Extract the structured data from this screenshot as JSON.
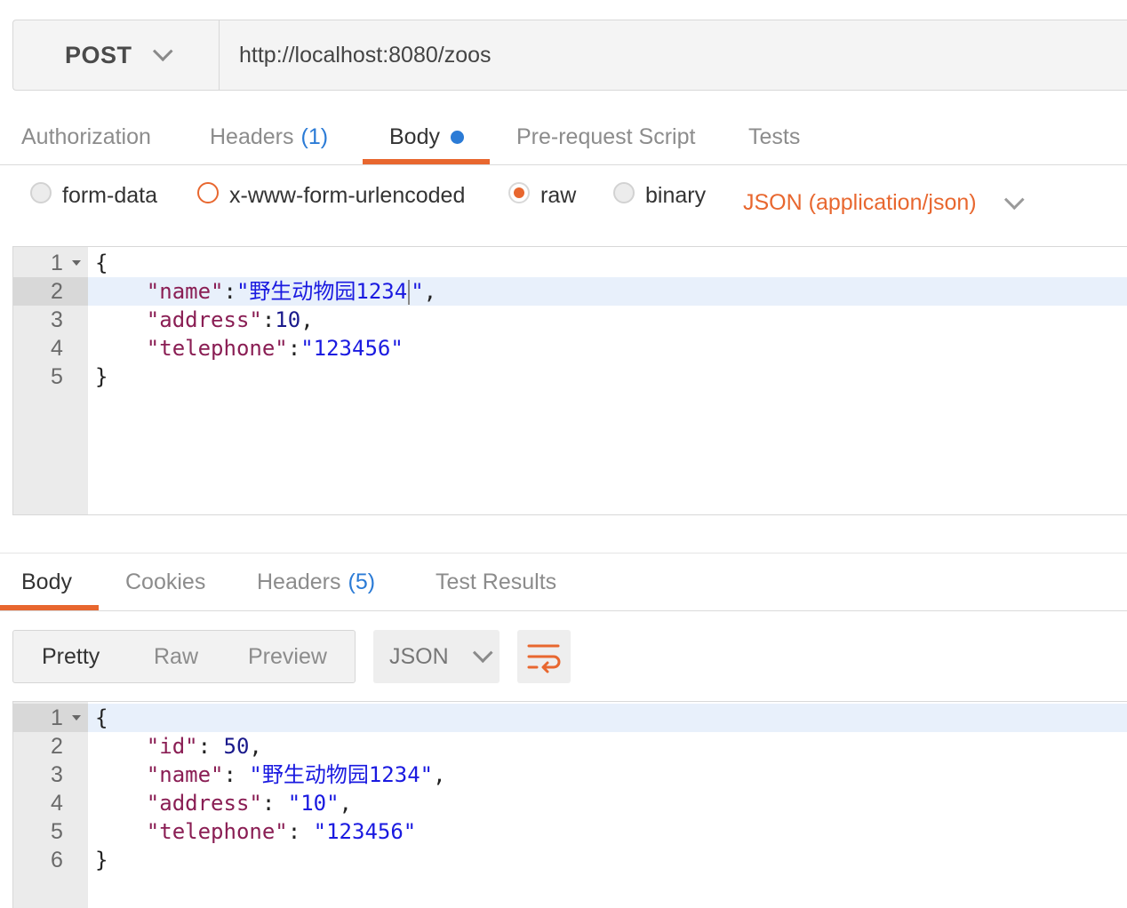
{
  "request": {
    "method": "POST",
    "url": "http://localhost:8080/zoos",
    "tabs": {
      "authorization": "Authorization",
      "headers": "Headers",
      "headers_count": "(1)",
      "body": "Body",
      "prerequest": "Pre-request Script",
      "tests": "Tests"
    },
    "body_types": {
      "form_data": "form-data",
      "urlencoded": "x-www-form-urlencoded",
      "raw": "raw",
      "binary": "binary"
    },
    "content_type": "JSON (application/json)",
    "code": {
      "ln1": "1",
      "ln2": "2",
      "ln3": "3",
      "ln4": "4",
      "ln5": "5",
      "l1": "{",
      "l2_key": "\"name\"",
      "l2_colon": ":",
      "l2_val": "\"野生动物园1234",
      "l2_val_end": "\"",
      "l2_comma": ",",
      "l3_key": "\"address\"",
      "l3_colon": ":",
      "l3_val": "10",
      "l3_comma": ",",
      "l4_key": "\"telephone\"",
      "l4_colon": ":",
      "l4_val": "\"123456\"",
      "l5": "}"
    }
  },
  "response": {
    "tabs": {
      "body": "Body",
      "cookies": "Cookies",
      "headers": "Headers",
      "headers_count": "(5)",
      "test_results": "Test Results"
    },
    "views": {
      "pretty": "Pretty",
      "raw": "Raw",
      "preview": "Preview"
    },
    "format": "JSON",
    "code": {
      "ln1": "1",
      "ln2": "2",
      "ln3": "3",
      "ln4": "4",
      "ln5": "5",
      "ln6": "6",
      "l1": "{",
      "l2_key": "\"id\"",
      "l2_colon": ": ",
      "l2_val": "50",
      "l2_comma": ",",
      "l3_key": "\"name\"",
      "l3_colon": ": ",
      "l3_val": "\"野生动物园1234\"",
      "l3_comma": ",",
      "l4_key": "\"address\"",
      "l4_colon": ": ",
      "l4_val": "\"10\"",
      "l4_comma": ",",
      "l5_key": "\"telephone\"",
      "l5_colon": ": ",
      "l5_val": "\"123456\"",
      "l6": "}"
    }
  },
  "colors": {
    "accent": "#e8672f",
    "link_blue": "#2b7bd6"
  },
  "icons": {
    "method_dropdown": "chevron-down-icon",
    "content_type_dropdown": "chevron-down-icon",
    "format_dropdown": "chevron-down-icon",
    "wrap": "wrap-lines-icon",
    "fold": "fold-arrow-icon"
  }
}
